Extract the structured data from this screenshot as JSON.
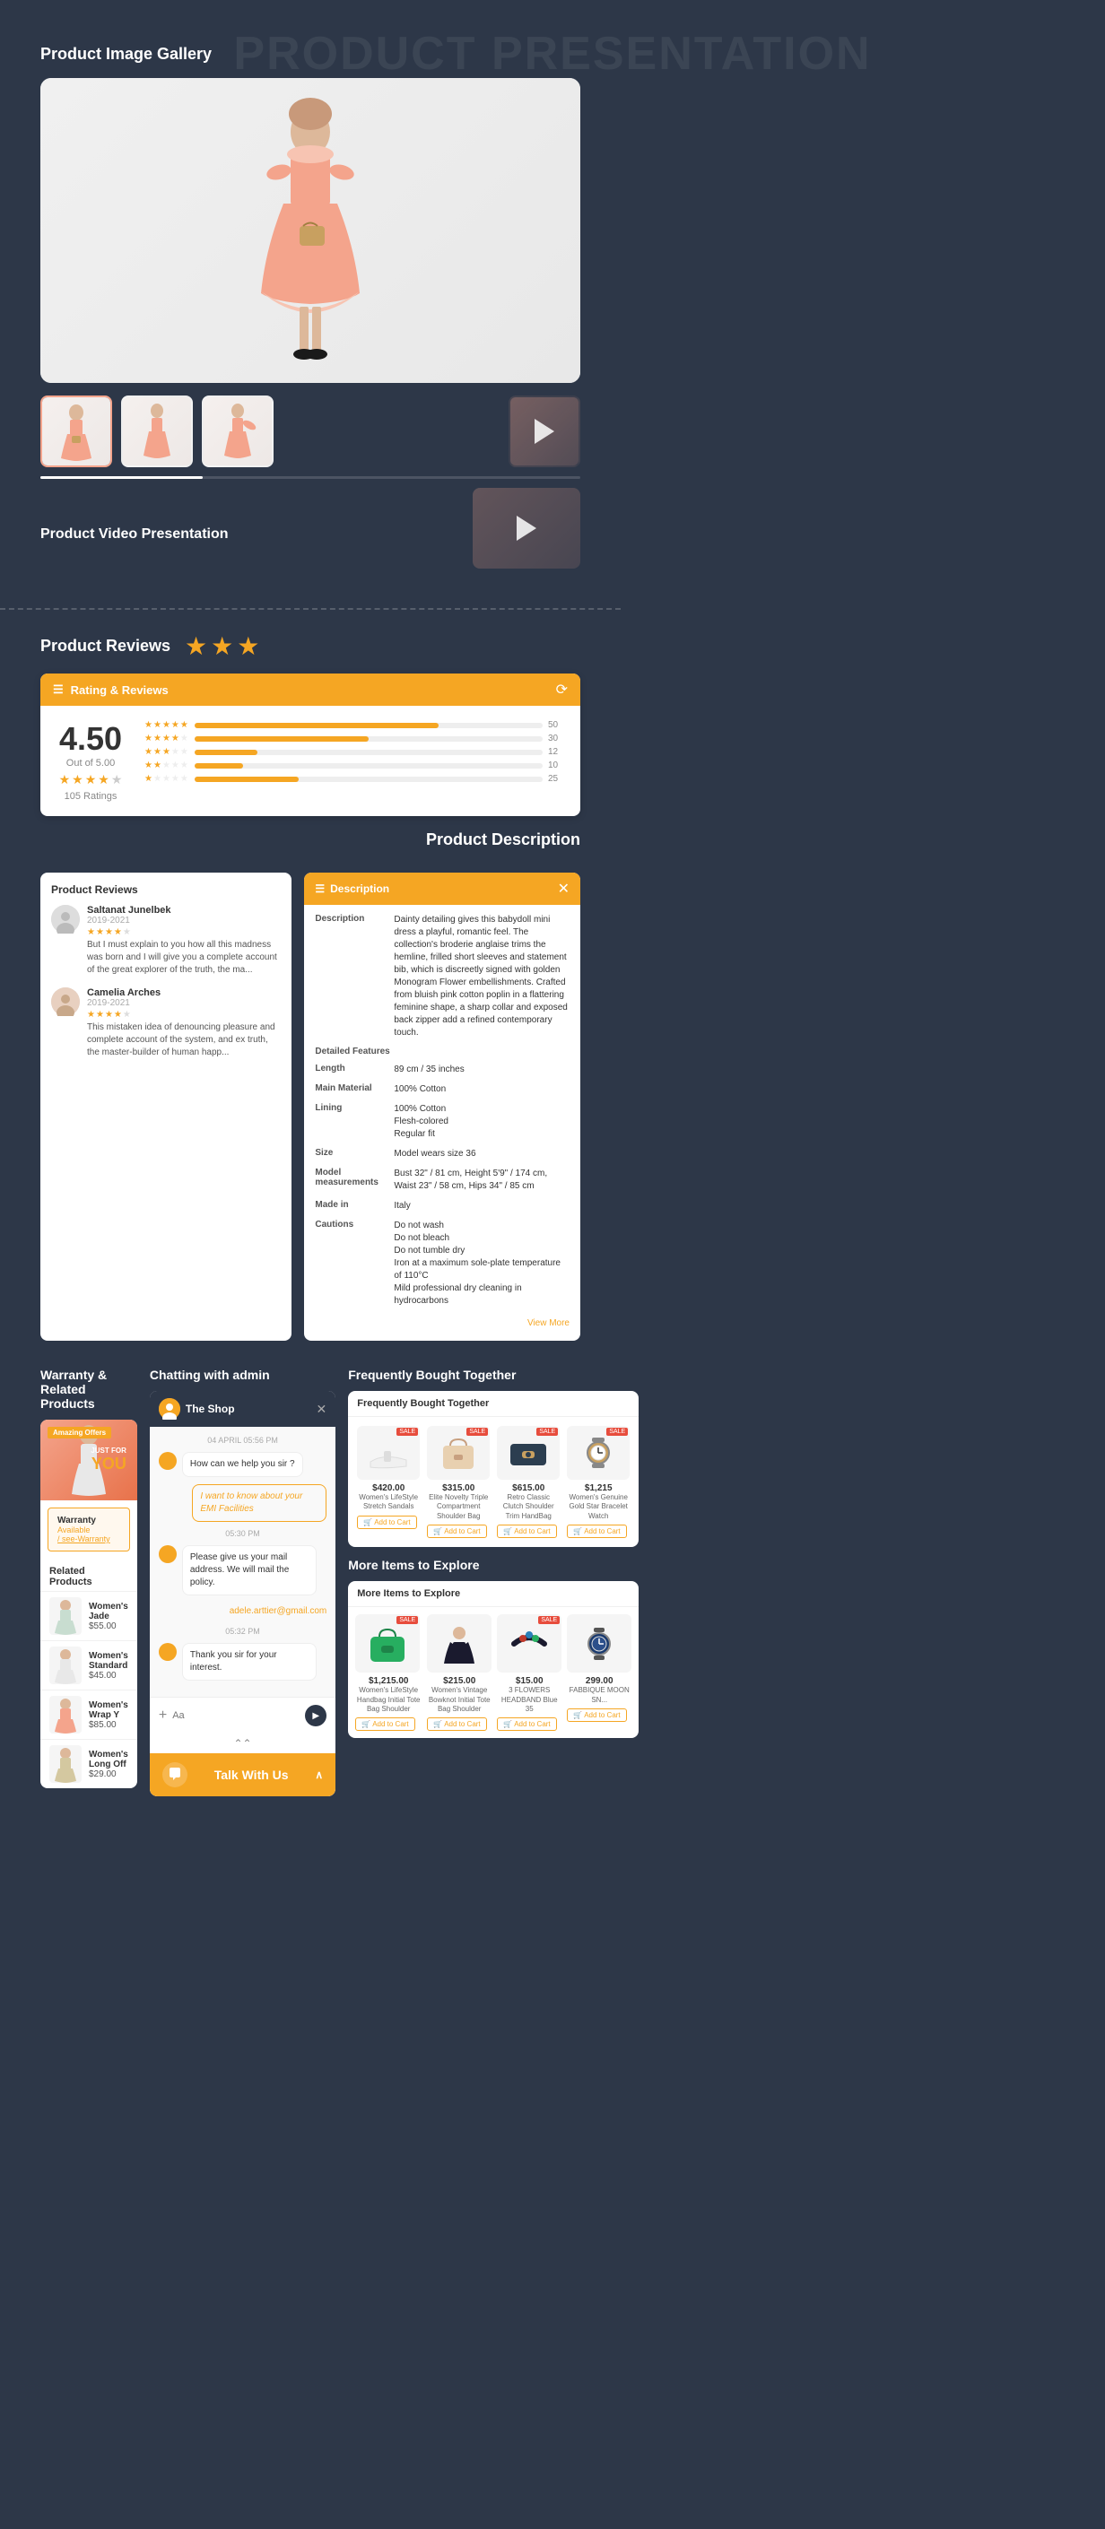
{
  "page": {
    "bg_title": "PRODUCT PRESENTATION",
    "gallery": {
      "title": "Product Image Gallery",
      "video_section_title": "Product Video Presentation",
      "thumbnails": [
        {
          "id": 1,
          "active": true,
          "type": "dress"
        },
        {
          "id": 2,
          "active": false,
          "type": "dress"
        },
        {
          "id": 3,
          "active": false,
          "type": "dress"
        },
        {
          "id": 4,
          "active": false,
          "type": "video"
        }
      ]
    },
    "reviews": {
      "title": "Product Reviews",
      "rating_header": "Rating & Reviews",
      "score": "4.50",
      "out_of": "Out of 5.00",
      "count": "105 Ratings",
      "bars": [
        {
          "stars": 5,
          "fill": 70,
          "count": "50"
        },
        {
          "stars": 4,
          "fill": 50,
          "count": "30"
        },
        {
          "stars": 3,
          "fill": 18,
          "count": "12"
        },
        {
          "stars": 2,
          "fill": 14,
          "count": "10"
        },
        {
          "stars": 1,
          "fill": 30,
          "count": "25"
        }
      ],
      "reviewers": [
        {
          "name": "Saltanat Junelbek",
          "date": "2019-2021",
          "stars": 4,
          "text": "But I must explain to you how all this madness was born and I will give you a complete account of the great explorer of the truth, the ma..."
        },
        {
          "name": "Camelia Arches",
          "date": "2019-2021",
          "stars": 4,
          "text": "This mistaken idea of denouncing pleasure and complete account of the system, and ex truth, the master-builder of human happ..."
        }
      ]
    },
    "product_description": {
      "title": "Product Description",
      "desc_header": "Description",
      "description": "Dainty detailing gives this babydoll mini dress a playful, romantic feel. The collection's broderie anglaise trims the hemline, frilled short sleeves and statement bib, which is discreetly signed with golden Monogram Flower embellishments. Crafted from bluish pink cotton poplin in a flattering feminine shape, a sharp collar and exposed back zipper add a refined contemporary touch.",
      "features": [
        {
          "label": "Description",
          "value": "Dainty detailing gives this babydoll mini dress..."
        },
        {
          "label": "Detailed Features",
          "value": ""
        },
        {
          "label": "Length",
          "value": "89 cm / 35 inches"
        },
        {
          "label": "Main Material",
          "value": "100% Cotton"
        },
        {
          "label": "Lining",
          "value": "100% Cotton"
        },
        {
          "label": "",
          "value": "Flesh-colored"
        },
        {
          "label": "",
          "value": "Regular fit"
        },
        {
          "label": "Size",
          "value": "Model wears size 36"
        },
        {
          "label": "Model measurements",
          "value": "Bust 32\" / 81 cm, Height 5'9\" / 174 cm, Waist 23\" / 58 cm, Hips 34\" / 85 cm"
        },
        {
          "label": "Made in",
          "value": "Italy"
        },
        {
          "label": "Cautions",
          "value": "Do not wash\nDo not bleach\nDo not tumble dry\nIron at a maximum sole-plate temperature of 110°C\nMild professional dry cleaning in hydrocarbons"
        }
      ],
      "view_more": "View More"
    },
    "warranty": {
      "panel_title": "Warranty &\nRelated Products",
      "promo_badge": "Amazing Offers",
      "promo_text": "JUST FOR\nYOU",
      "warranty_label": "Warranty",
      "warranty_avail": "Available",
      "warranty_link": "/ see-Warranty",
      "related_title": "Related Products",
      "related_items": [
        {
          "name": "Women's Jade",
          "price": "$55.00",
          "color": "#c8ddd0"
        },
        {
          "name": "Women's Standard",
          "price": "$45.00",
          "color": "#e8e8e8"
        },
        {
          "name": "Women's Wrap Y",
          "price": "$85.00",
          "color": "#f4a48c"
        },
        {
          "name": "Women's Long Off",
          "price": "$29.00",
          "color": "#d4c8a0"
        }
      ]
    },
    "chat": {
      "panel_title": "Chatting with admin",
      "shop_name": "The Shop",
      "close_label": "✕",
      "timestamp1": "04 APRIL 05:56 PM",
      "msg1": "How can we help you sir ?",
      "user_msg1": "I want to know about your EMI Facilities",
      "timestamp2": "05:30 PM",
      "msg2": "Please give us your mail address. We will mail the policy.",
      "user_email": "adele.arttier@gmail.com",
      "timestamp3": "05:32 PM",
      "msg3": "Thank you sir for your interest.",
      "input_placeholder": "Aa",
      "talk_btn_label": "Talk With Us"
    },
    "fbt": {
      "panel_title": "Frequently Bought Together",
      "header": "Frequently Bought Together",
      "items": [
        {
          "name": "Women's LifeStyle Stretch Sandals",
          "price": "$420.00",
          "type": "shoe",
          "sale": true
        },
        {
          "name": "Elite Novelty Triple Compartment Shoulder Bag",
          "price": "$315.00",
          "type": "bag",
          "sale": true
        },
        {
          "name": "Retro Classic Clutch Shoulder Trim HandBag",
          "price": "$615.00",
          "type": "wallet",
          "sale": true
        },
        {
          "name": "Women's Genuine Gold Star Bracelet Watch",
          "price": "$1,215",
          "type": "watch",
          "sale": true
        }
      ],
      "add_to_cart": "Add to Cart"
    },
    "more_items": {
      "title": "More Items to Explore",
      "header": "More Items to Explore",
      "items": [
        {
          "name": "Women's LifeStyle Handbag Initial Tote Bag Shoulder",
          "price": "$1,215.00",
          "type": "handbag",
          "sale": true
        },
        {
          "name": "Women's Vintage Bowknot Initial Tote Bag Shoulder",
          "price": "$215.00",
          "type": "sundress",
          "sale": false
        },
        {
          "name": "3 FLOWERS HEADBAND Blue 35",
          "price": "$15.00",
          "type": "headband",
          "sale": true
        },
        {
          "name": "FABBIQUE MOON SN...",
          "price": "299.00",
          "type": "watch2",
          "sale": false
        }
      ],
      "add_to_cart": "Add to Cart"
    }
  }
}
